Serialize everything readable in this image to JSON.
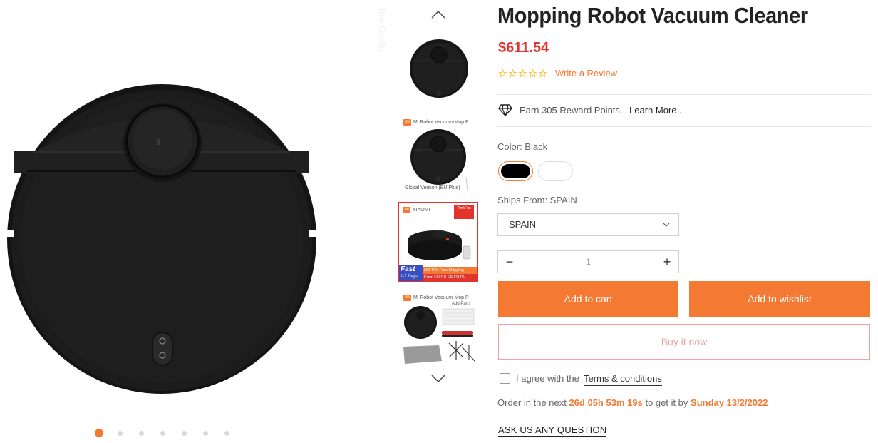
{
  "gallery": {
    "side_text": "Buy Quality",
    "dots_count": 7,
    "active_dot": 0
  },
  "thumbnails": {
    "t2_title": "Mi Robot Vacuum-Mop P",
    "t2_footer": "Global Version (EU Plus)",
    "t3_brand": "XIAOMI",
    "t3_badge_top": "TimkFun",
    "t3_fast": "Fast",
    "t3_days": "1-7 Days",
    "t3_banner": "NO TAX  Free Shipping",
    "t3_from": "From EU RU ES FR PL",
    "t4_title": "Mi Robot Vacuum-Mop P",
    "t4_subtitle": "Add Parts"
  },
  "product": {
    "title": "Mopping Robot Vacuum Cleaner",
    "price": "$611.54",
    "rating": 0,
    "review_link": "Write a Review",
    "reward_text": "Earn 305 Reward Points.",
    "reward_link": "Learn More...",
    "color_label": "Color: Black",
    "colors": [
      "Black",
      "White"
    ],
    "ships_label": "Ships From: SPAIN",
    "ships_value": "SPAIN",
    "quantity": "1",
    "qty_minus": "−",
    "qty_plus": "+"
  },
  "actions": {
    "add_to_cart": "Add to cart",
    "add_to_wishlist": "Add to wishlist",
    "buy_now": "Buy it now",
    "agree_text": "I agree with the",
    "terms_link": "Terms & conditions",
    "order_prefix": "Order in the next",
    "countdown": "26d 05h 53m 19s",
    "order_mid": "to get it by",
    "delivery_date": "Sunday 13/2/2022",
    "ask_question": "ASK US ANY QUESTION"
  },
  "colors": {
    "accent": "#f47932",
    "price": "#e0342c",
    "buy_now_border": "#f0a1a1"
  }
}
